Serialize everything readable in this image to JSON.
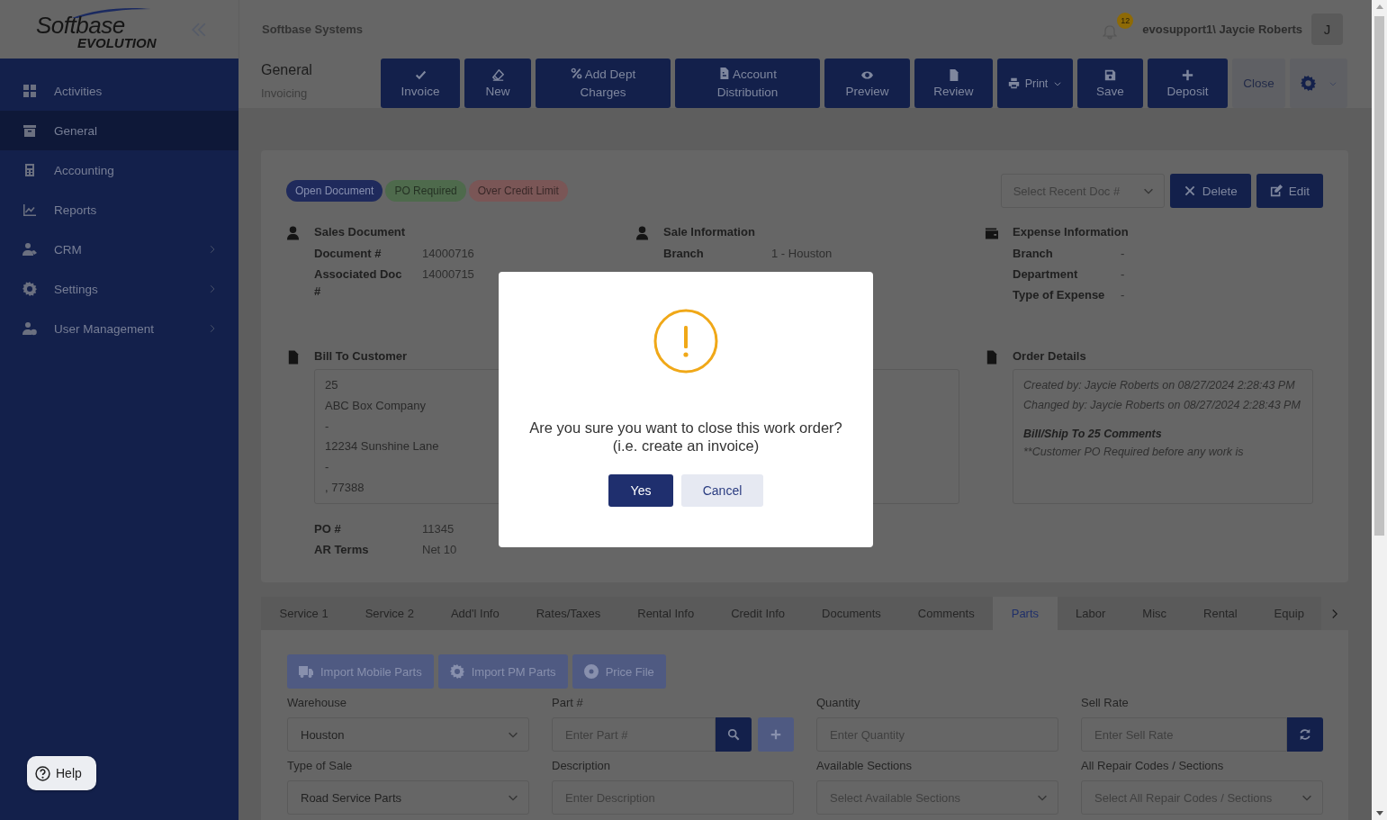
{
  "logo": {
    "line1": "Softbase",
    "line2": "EVOLUTION"
  },
  "sidebar": {
    "items": [
      {
        "label": "Activities",
        "selected": false,
        "has_children": false
      },
      {
        "label": "General",
        "selected": true,
        "has_children": false
      },
      {
        "label": "Accounting",
        "selected": false,
        "has_children": false
      },
      {
        "label": "Reports",
        "selected": false,
        "has_children": false
      },
      {
        "label": "CRM",
        "selected": false,
        "has_children": true
      },
      {
        "label": "Settings",
        "selected": false,
        "has_children": true
      },
      {
        "label": "User Management",
        "selected": false,
        "has_children": true
      }
    ]
  },
  "header": {
    "company": "Softbase Systems",
    "notifications": "12",
    "user": "evosupport1\\ Jaycie Roberts",
    "avatar": "J"
  },
  "page": {
    "title": "General",
    "subtitle": "Invoicing"
  },
  "toolbar": [
    {
      "label": "Invoice",
      "kind": "stacked"
    },
    {
      "label": "New",
      "kind": "stacked"
    },
    {
      "label": "Add Dept Charges",
      "kind": "inline"
    },
    {
      "label": "Account Distribution",
      "kind": "inline"
    },
    {
      "label": "Preview",
      "kind": "stacked"
    },
    {
      "label": "Review",
      "kind": "stacked"
    },
    {
      "label": "Print",
      "kind": "dropdown"
    },
    {
      "label": "Save",
      "kind": "stacked"
    },
    {
      "label": "Deposit",
      "kind": "stacked"
    },
    {
      "label": "Close",
      "kind": "plain"
    },
    {
      "kind": "menu"
    }
  ],
  "card": {
    "badges": [
      {
        "label": "Open Document",
        "color": "#1f2a5c"
      },
      {
        "label": "PO Required",
        "color": "#4e6a4c"
      },
      {
        "label": "Over Credit Limit",
        "color": "#7a5656"
      }
    ],
    "recent_doc": {
      "placeholder": "Select Recent Doc #"
    },
    "actions": [
      {
        "label": "Delete"
      },
      {
        "label": "Edit"
      }
    ],
    "sections": [
      {
        "title": "Sales Document",
        "rows": [
          {
            "label": "Document #",
            "value": "14000716"
          },
          {
            "label": "Associated Doc #",
            "value": "14000715"
          }
        ]
      },
      {
        "title": "Sale Information",
        "rows": [
          {
            "label": "Branch",
            "value": "1 - Houston"
          }
        ]
      },
      {
        "title": "Expense Information",
        "rows": [
          {
            "label": "Branch",
            "value": "-"
          },
          {
            "label": "Department",
            "value": "-"
          },
          {
            "label": "Type of Expense",
            "value": "-"
          }
        ]
      }
    ],
    "bill_to": {
      "title": "Bill To Customer",
      "lines": [
        "25",
        "ABC Box Company",
        "-",
        "12234 Sunshine Lane",
        "-",
        ", 77388"
      ],
      "rows": [
        {
          "label": "PO #",
          "value": "11345"
        },
        {
          "label": "AR Terms",
          "value": "Net 10"
        }
      ]
    },
    "order_details": {
      "title": "Order Details",
      "notes": [
        {
          "kind": "note",
          "text": "Created by: Jaycie Roberts on 08/27/2024 2:28:43 PM"
        },
        {
          "kind": "note",
          "text": "Changed by: Jaycie Roberts on 08/27/2024 2:28:43 PM"
        },
        {
          "kind": "heading",
          "text": "Bill/Ship To 25 Comments"
        },
        {
          "kind": "note",
          "text": "**Customer PO Required before any work is"
        }
      ]
    }
  },
  "tabs": [
    {
      "label": "Service 1",
      "selected": false
    },
    {
      "label": "Service 2",
      "selected": false
    },
    {
      "label": "Add'l Info",
      "selected": false
    },
    {
      "label": "Rates/Taxes",
      "selected": false
    },
    {
      "label": "Rental Info",
      "selected": false
    },
    {
      "label": "Credit Info",
      "selected": false
    },
    {
      "label": "Documents",
      "selected": false
    },
    {
      "label": "Comments",
      "selected": false
    },
    {
      "label": "Parts",
      "selected": true
    },
    {
      "label": "Labor",
      "selected": false
    },
    {
      "label": "Misc",
      "selected": false
    },
    {
      "label": "Rental",
      "selected": false
    },
    {
      "label": "Equip",
      "selected": false
    }
  ],
  "parts": {
    "imports": [
      {
        "label": "Import Mobile Parts"
      },
      {
        "label": "Import PM Parts"
      },
      {
        "label": "Price File"
      }
    ],
    "fields": [
      {
        "label": "Warehouse",
        "kind": "select",
        "value": "Houston"
      },
      {
        "label": "Part #",
        "kind": "search",
        "placeholder": "Enter Part #"
      },
      {
        "label": "Quantity",
        "kind": "input",
        "placeholder": "Enter Quantity"
      },
      {
        "label": "Sell Rate",
        "kind": "refresh",
        "placeholder": "Enter Sell Rate"
      },
      {
        "label": "Type of Sale",
        "kind": "select",
        "value": "Road Service Parts"
      },
      {
        "label": "Description",
        "kind": "input",
        "placeholder": "Enter Description"
      },
      {
        "label": "Available Sections",
        "kind": "select",
        "placeholder": "Select Available Sections"
      },
      {
        "label": "All Repair Codes / Sections",
        "kind": "select",
        "placeholder": "Select All Repair Codes / Sections"
      }
    ]
  },
  "help": {
    "label": "Help"
  },
  "dialog": {
    "message": [
      "Are you sure you want to close this work order?",
      "(i.e. create an invoice)"
    ],
    "buttons": [
      {
        "label": "Yes",
        "kind": "primary"
      },
      {
        "label": "Cancel",
        "kind": "secondary"
      }
    ]
  }
}
